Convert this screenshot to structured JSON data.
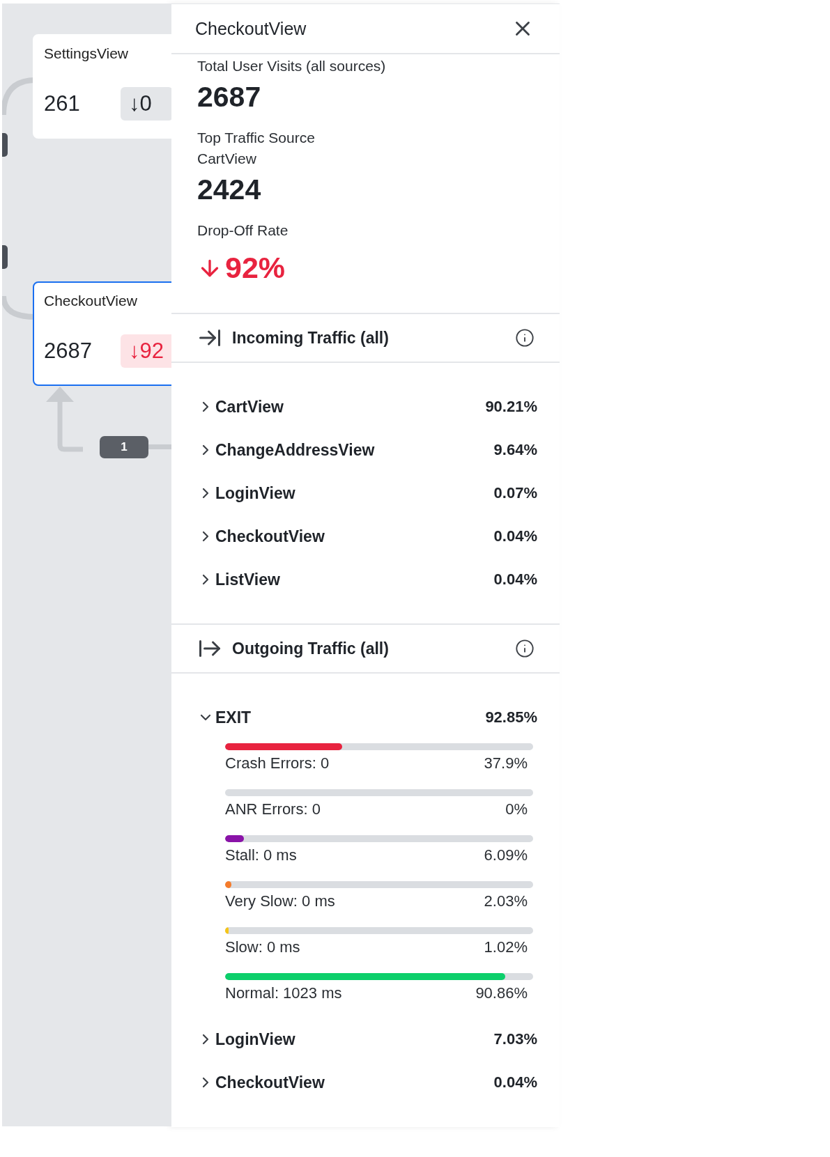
{
  "canvas": {
    "nodes": [
      {
        "title": "SettingsView",
        "count": "261",
        "change": "↓0",
        "alert": false,
        "selected": false
      },
      {
        "title": "CheckoutView",
        "count": "2687",
        "change": "↓92",
        "alert": true,
        "selected": true
      }
    ],
    "edge_badge": "1"
  },
  "panel": {
    "title": "CheckoutView",
    "stats": [
      {
        "kind": "number",
        "label": "Total User Visits (all sources)",
        "value": "2687"
      },
      {
        "kind": "source",
        "label": "Top Traffic Source",
        "source": "CartView",
        "value": "2424"
      },
      {
        "kind": "rate",
        "label": "Drop-Off Rate",
        "value": "92%"
      }
    ],
    "sections": [
      {
        "kind": "incoming",
        "title": "Incoming Traffic (all)",
        "items": [
          {
            "label": "CartView",
            "value": "90.21%",
            "expanded": false
          },
          {
            "label": "ChangeAddressView",
            "value": "9.64%",
            "expanded": false
          },
          {
            "label": "LoginView",
            "value": "0.07%",
            "expanded": false
          },
          {
            "label": "CheckoutView",
            "value": "0.04%",
            "expanded": false
          },
          {
            "label": "ListView",
            "value": "0.04%",
            "expanded": false
          }
        ]
      },
      {
        "kind": "outgoing",
        "title": "Outgoing Traffic (all)",
        "items": [
          {
            "label": "EXIT",
            "value": "92.85%",
            "expanded": true,
            "metrics": [
              {
                "label": "Crash Errors: 0",
                "value": "37.9%",
                "level": 0.379,
                "color": "#e8233f"
              },
              {
                "label": "ANR Errors: 0",
                "value": "0%",
                "level": 0
              },
              {
                "label": "Stall: 0 ms",
                "value": "6.09%",
                "level": 0.0609,
                "color": "#8a13a8"
              },
              {
                "label": "Very Slow: 0 ms",
                "value": "2.03%",
                "level": 0.0203,
                "color": "#f57c2b"
              },
              {
                "label": "Slow: 0 ms",
                "value": "1.02%",
                "level": 0.0102,
                "color": "#f5c518"
              },
              {
                "label": "Normal: 1023 ms",
                "value": "90.86%",
                "level": 0.9086,
                "color": "#0ccf6b"
              }
            ]
          },
          {
            "label": "LoginView",
            "value": "7.03%",
            "expanded": false
          },
          {
            "label": "CheckoutView",
            "value": "0.04%",
            "expanded": false
          }
        ]
      }
    ]
  }
}
